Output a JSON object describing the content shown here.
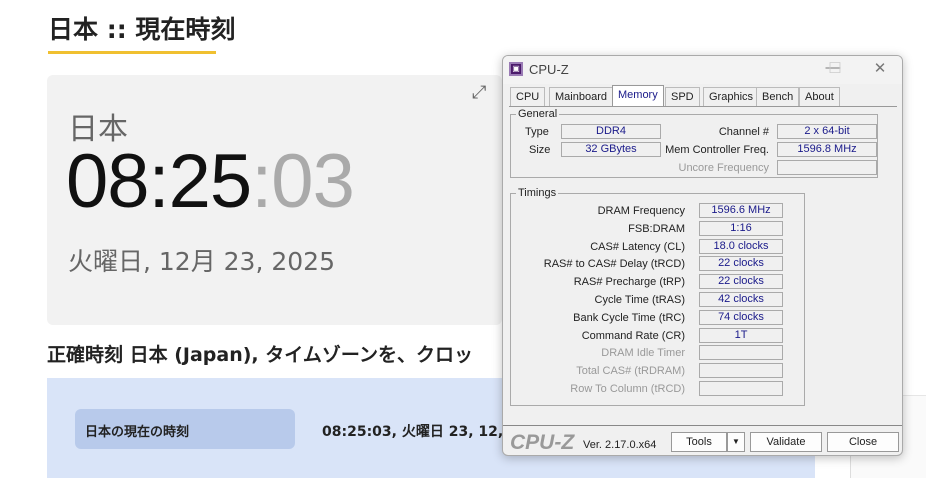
{
  "page": {
    "title": "日本 :: 現在時刻",
    "country": "日本",
    "time_hm": "08:25",
    "time_sec": ":03",
    "date": "火曜日, 12月 23, 2025",
    "heading": "正確時刻 日本 (Japan), タイムゾーンを、クロッ",
    "current_label": "日本の現在の時刻",
    "current_value": "08:25:03, 火曜日 23, 12,",
    "accent": "#f0c030"
  },
  "window": {
    "title": "CPU-Z",
    "tabs": [
      "CPU",
      "Mainboard",
      "Memory",
      "SPD",
      "Graphics",
      "Bench",
      "About"
    ],
    "selected_tab": "Memory",
    "general": {
      "title": "General",
      "type_label": "Type",
      "type": "DDR4",
      "size_label": "Size",
      "size": "32 GBytes",
      "channel_label": "Channel #",
      "channel": "2 x 64-bit",
      "mcf_label": "Mem Controller Freq.",
      "mcf": "1596.8 MHz",
      "uncore_label": "Uncore Frequency",
      "uncore": ""
    },
    "timings": {
      "title": "Timings",
      "rows": [
        {
          "label": "DRAM Frequency",
          "value": "1596.6 MHz"
        },
        {
          "label": "FSB:DRAM",
          "value": "1:16"
        },
        {
          "label": "CAS# Latency (CL)",
          "value": "18.0 clocks"
        },
        {
          "label": "RAS# to CAS# Delay (tRCD)",
          "value": "22 clocks"
        },
        {
          "label": "RAS# Precharge (tRP)",
          "value": "22 clocks"
        },
        {
          "label": "Cycle Time (tRAS)",
          "value": "42 clocks"
        },
        {
          "label": "Bank Cycle Time (tRC)",
          "value": "74 clocks"
        },
        {
          "label": "Command Rate (CR)",
          "value": "1T"
        },
        {
          "label": "DRAM Idle Timer",
          "value": "",
          "disabled": true
        },
        {
          "label": "Total CAS# (tRDRAM)",
          "value": "",
          "disabled": true
        },
        {
          "label": "Row To Column (tRCD)",
          "value": "",
          "disabled": true
        }
      ]
    },
    "footer": {
      "logo": "CPU-Z",
      "version": "Ver. 2.17.0.x64",
      "tools": "Tools",
      "validate": "Validate",
      "close": "Close"
    }
  }
}
